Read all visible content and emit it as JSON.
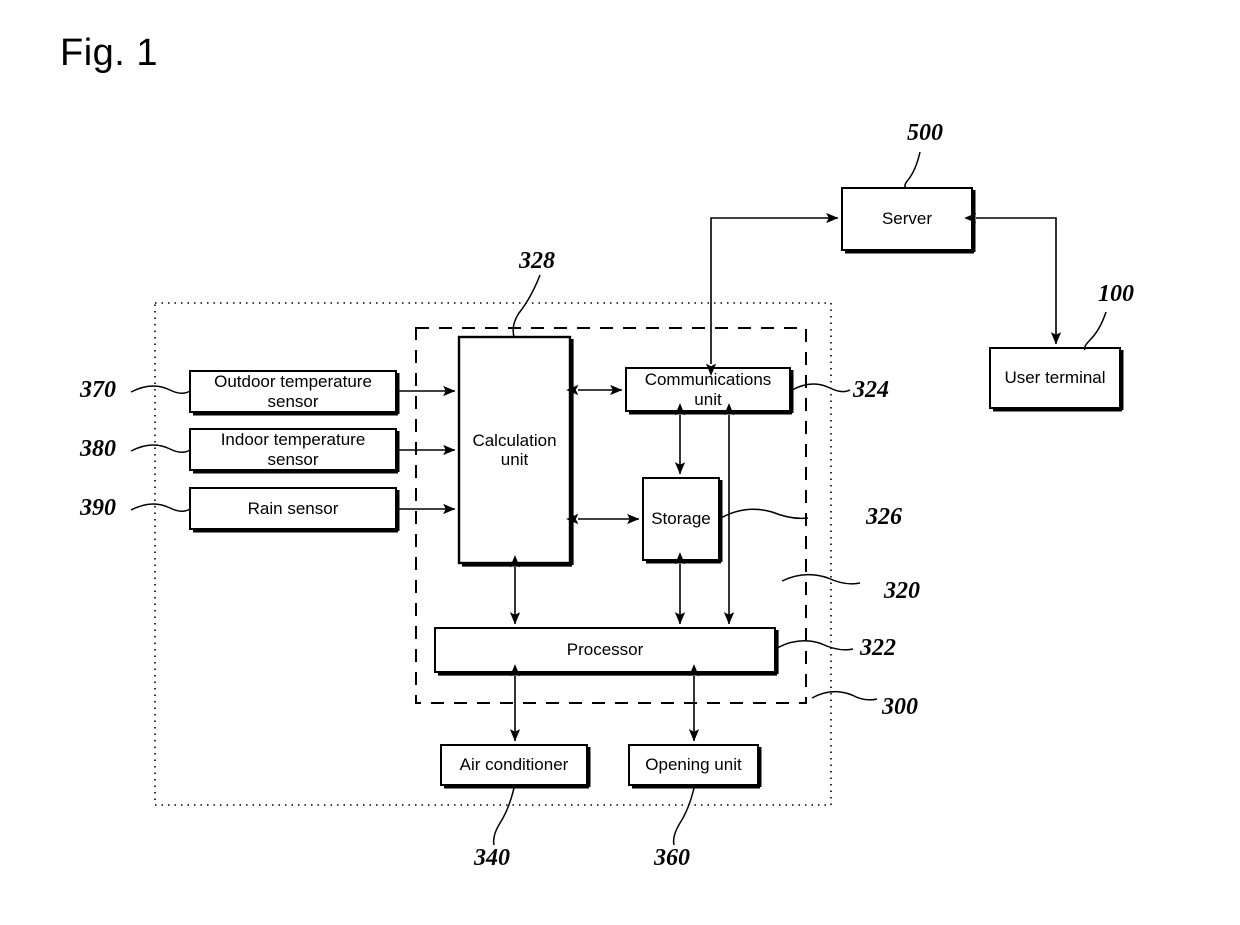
{
  "figure": {
    "title": "Fig. 1",
    "type": "patent-block-diagram"
  },
  "blocks": {
    "outdoor_temp_sensor": {
      "label": "Outdoor temperature sensor",
      "ref": "370"
    },
    "indoor_temp_sensor": {
      "label": "Indoor temperature sensor",
      "ref": "380"
    },
    "rain_sensor": {
      "label": "Rain sensor",
      "ref": "390"
    },
    "calculation_unit": {
      "label": "Calculation unit",
      "ref": "328"
    },
    "communications_unit": {
      "label": "Communications unit",
      "ref": "324"
    },
    "storage": {
      "label": "Storage",
      "ref": "326"
    },
    "processor": {
      "label": "Processor",
      "ref": "322"
    },
    "air_conditioner": {
      "label": "Air conditioner",
      "ref": "340"
    },
    "opening_unit": {
      "label": "Opening unit",
      "ref": "360"
    },
    "server": {
      "label": "Server",
      "ref": "500"
    },
    "user_terminal": {
      "label": "User terminal",
      "ref": "100"
    }
  },
  "containers": {
    "inner_control_module": {
      "ref": "320"
    },
    "outer_system": {
      "ref": "300"
    }
  },
  "reference_numerals": {
    "n100": "100",
    "n300": "300",
    "n320": "320",
    "n322": "322",
    "n324": "324",
    "n326": "326",
    "n328": "328",
    "n340": "340",
    "n360": "360",
    "n370": "370",
    "n380": "380",
    "n390": "390",
    "n500": "500"
  },
  "colors": {
    "line": "#000000",
    "background": "#ffffff"
  }
}
